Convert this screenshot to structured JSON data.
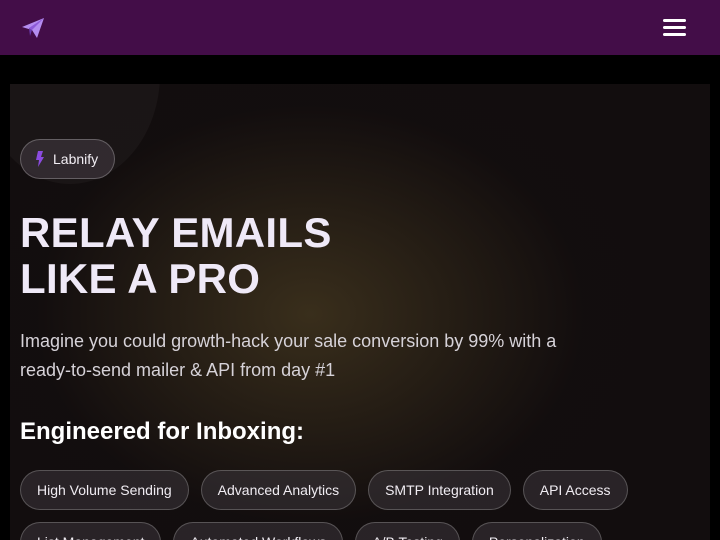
{
  "nav": {
    "logo_icon": "paper-plane-icon",
    "menu_icon": "hamburger-menu-icon",
    "background": "#430d48"
  },
  "hero": {
    "badge": {
      "icon": "lightning-bolt-icon",
      "label": "Labnify",
      "icon_color": "#8b4be0"
    },
    "headline_line1": "RELAY EMAILS",
    "headline_line2": "LIKE A PRO",
    "subtitle": "Imagine you could growth-hack your sale conversion by 99% with a ready-to-send mailer & API from day #1",
    "features_title": "Engineered for Inboxing:",
    "features": [
      "High Volume Sending",
      "Advanced Analytics",
      "SMTP Integration",
      "API Access",
      "List Management",
      "Automated Workflows",
      "A/B Testing",
      "Personalization"
    ]
  }
}
